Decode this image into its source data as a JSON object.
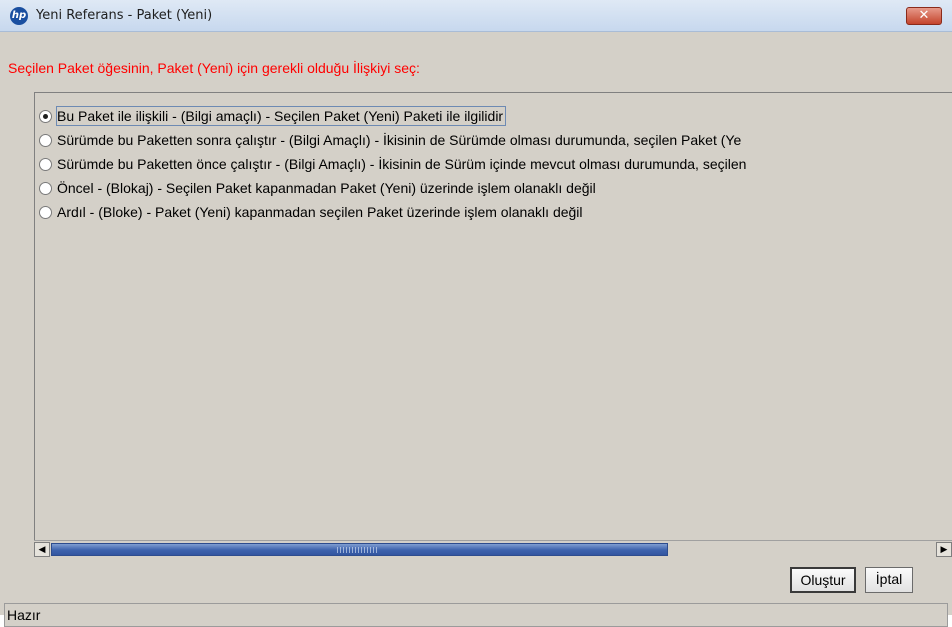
{
  "window": {
    "title": "Yeni Referans - Paket (Yeni)",
    "app_icon_text": "hp",
    "close_glyph": "✕"
  },
  "instruction": "Seçilen Paket öğesinin, Paket (Yeni) için gerekli olduğu İlişkiyi seç:",
  "options": [
    {
      "label": "Bu Paket ile ilişkili - (Bilgi amaçlı) - Seçilen Paket (Yeni)  Paketi ile ilgilidir",
      "checked": true
    },
    {
      "label": "Sürümde bu Paketten sonra çalıştır - (Bilgi Amaçlı) - İkisinin de Sürümde olması durumunda, seçilen Paket (Ye",
      "checked": false
    },
    {
      "label": "Sürümde bu Paketten önce çalıştır - (Bilgi Amaçlı) - İkisinin de Sürüm içinde mevcut olması durumunda, seçilen",
      "checked": false
    },
    {
      "label": "Öncel - (Blokaj) - Seçilen Paket kapanmadan Paket (Yeni) üzerinde işlem olanaklı değil",
      "checked": false
    },
    {
      "label": "Ardıl - (Bloke) - Paket (Yeni) kapanmadan seçilen Paket üzerinde işlem olanaklı değil",
      "checked": false
    }
  ],
  "scrollbar": {
    "left_arrow": "◀",
    "right_arrow": "▶"
  },
  "buttons": {
    "create": "Oluştur",
    "cancel": "İptal"
  },
  "status": "Hazır",
  "colors": {
    "instruction": "#ff0000",
    "scroll_thumb": "#3d62ad",
    "close_button": "#c4442c"
  }
}
